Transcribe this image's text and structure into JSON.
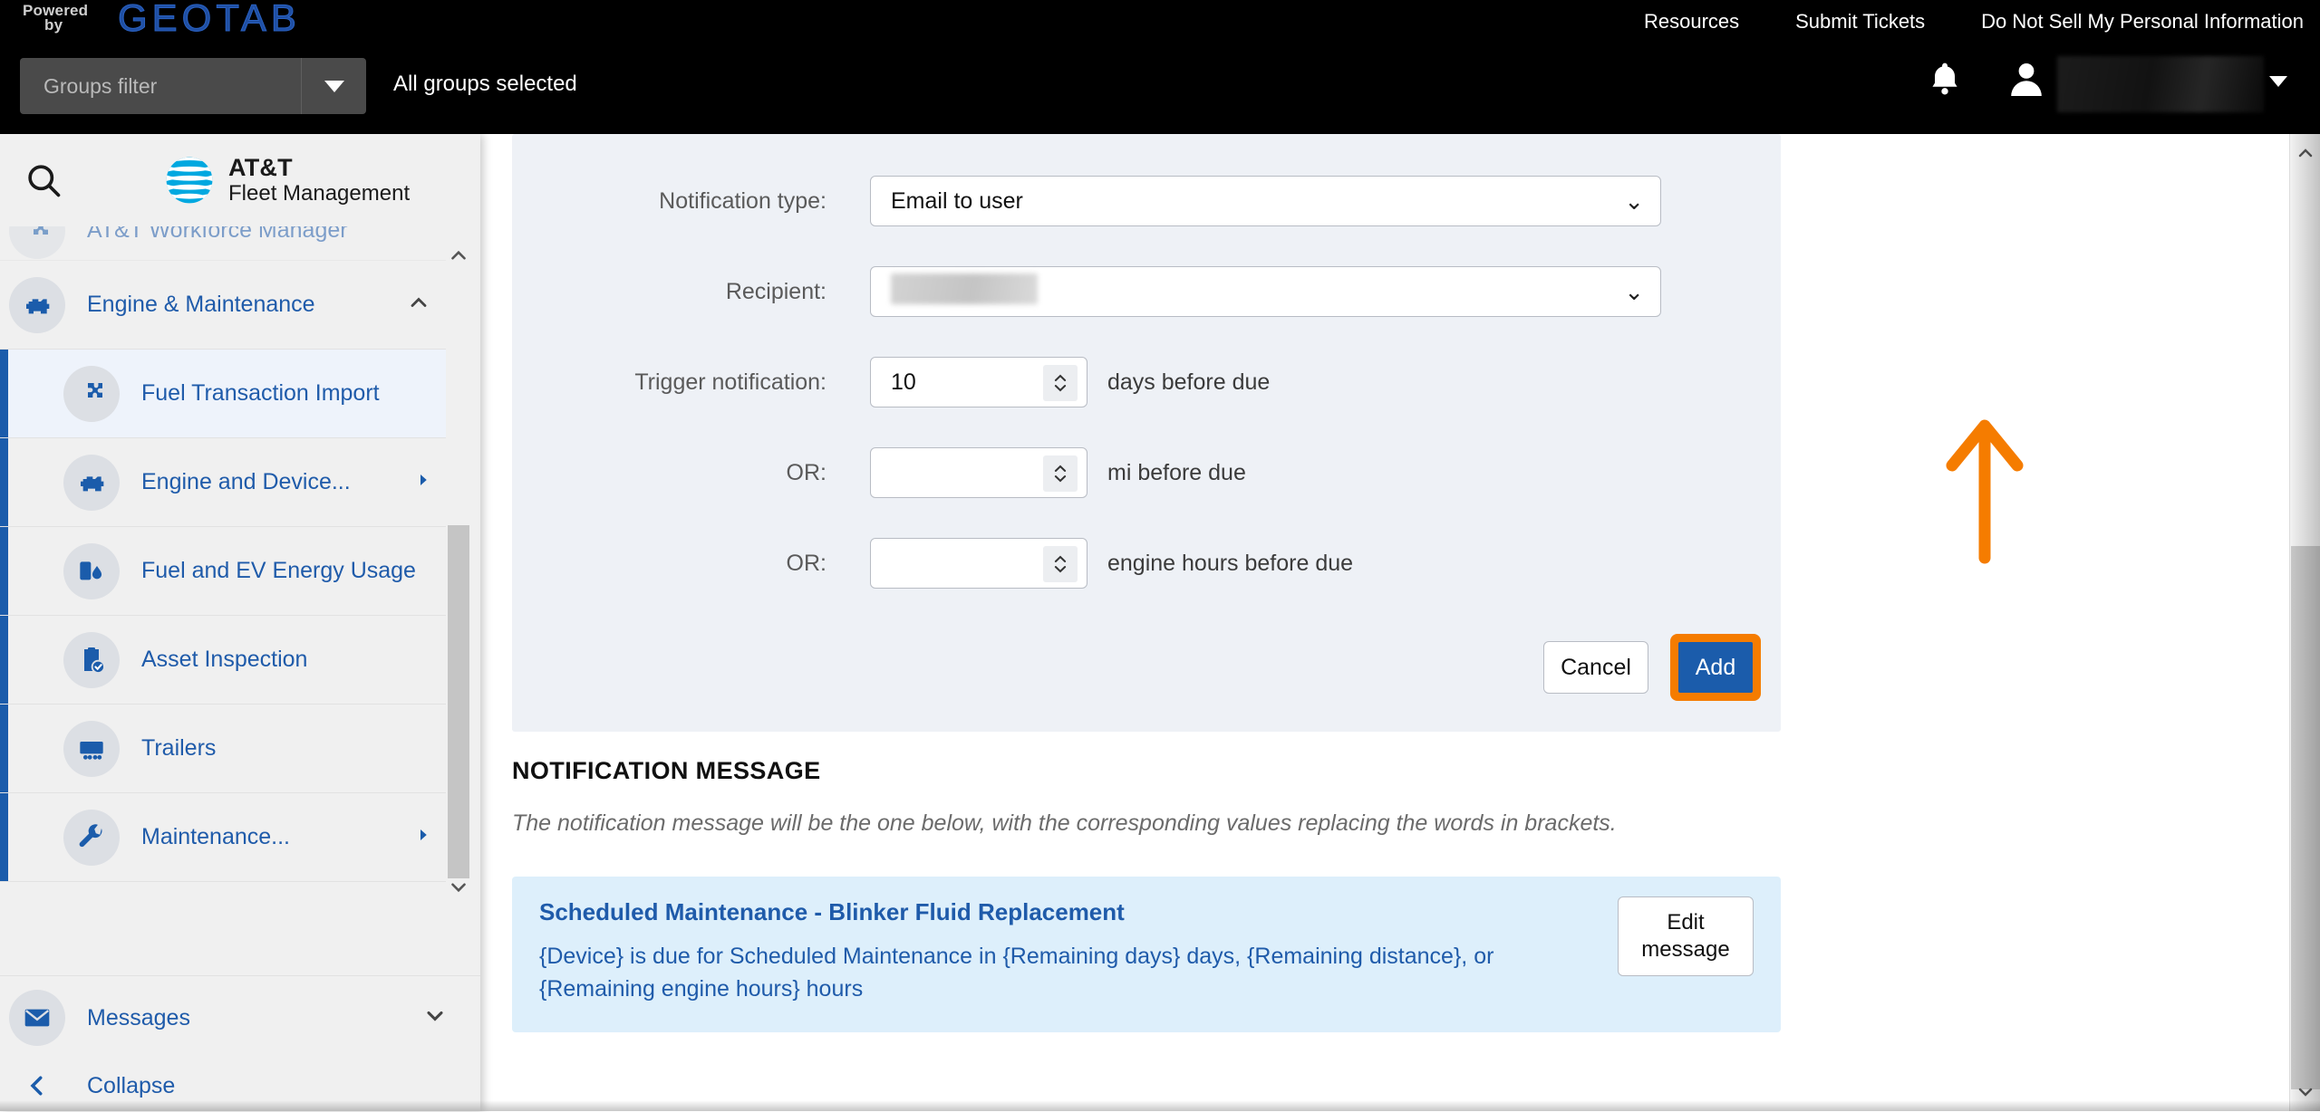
{
  "topbar": {
    "powered_line1": "Powered",
    "powered_line2": "by",
    "brand_logo": "GEOTAB",
    "nav_links": [
      {
        "label": "Resources"
      },
      {
        "label": "Submit Tickets"
      },
      {
        "label": "Do Not Sell My Personal Information"
      }
    ],
    "groups_filter_placeholder": "Groups filter",
    "groups_status": "All groups selected",
    "bell_icon": "notification-bell-icon",
    "user_icon": "user-avatar-icon",
    "user_name": "",
    "user_caret_icon": "caret-down-icon"
  },
  "sidebar": {
    "search_icon": "search-icon",
    "logo_icon": "att-globe-icon",
    "brand_line1": "AT&T",
    "brand_line2": "Fleet Management",
    "items": [
      {
        "label": "AT&T Workforce Manager",
        "icon": "puzzle-piece-icon",
        "level": "group",
        "chevron": "chevron-up-icon",
        "clipped": true
      },
      {
        "label": "Engine & Maintenance",
        "icon": "engine-icon",
        "level": "group",
        "chevron": "chevron-up-icon",
        "expanded": true
      },
      {
        "label": "Fuel Transaction Import",
        "icon": "puzzle-piece-icon",
        "level": "child",
        "active": true
      },
      {
        "label": "Engine and Device...",
        "icon": "engine-icon",
        "level": "child",
        "chevron": "chevron-right-icon"
      },
      {
        "label": "Fuel and EV Energy Usage",
        "icon": "fuel-ev-icon",
        "level": "child"
      },
      {
        "label": "Asset Inspection",
        "icon": "clipboard-check-icon",
        "level": "child"
      },
      {
        "label": "Trailers",
        "icon": "trailer-icon",
        "level": "child"
      },
      {
        "label": "Maintenance...",
        "icon": "wrench-icon",
        "level": "child",
        "chevron": "chevron-right-icon"
      }
    ],
    "bottom_items": [
      {
        "label": "Messages",
        "icon": "envelope-icon",
        "chevron": "chevron-down-icon"
      },
      {
        "label": "Collapse",
        "icon": "chevron-left-icon"
      }
    ],
    "scrollbar": {
      "up_icon": "chevron-up-icon",
      "down_icon": "chevron-down-icon"
    }
  },
  "form": {
    "rows": [
      {
        "label": "Notification type:",
        "value": "Email to user",
        "control": "select",
        "chevron": "chevron-down-icon"
      },
      {
        "label": "Recipient:",
        "value": "",
        "control": "select-redacted",
        "chevron": "chevron-down-icon"
      },
      {
        "label": "Trigger notification:",
        "value": "10",
        "control": "number",
        "unit": "days before due"
      },
      {
        "label": "OR:",
        "value": "",
        "control": "number",
        "unit": "mi before due"
      },
      {
        "label": "OR:",
        "value": "",
        "control": "number",
        "unit": "engine hours before due"
      }
    ],
    "cancel_label": "Cancel",
    "add_label": "Add"
  },
  "notification_message": {
    "section_title": "NOTIFICATION MESSAGE",
    "description": "The notification message will be the one below, with the corresponding values replacing the words in brackets.",
    "card_title": "Scheduled Maintenance - Blinker Fluid Replacement",
    "card_body": "{Device} is due for Scheduled Maintenance in {Remaining days} days, {Remaining distance}, or {Remaining engine hours} hours",
    "edit_line1": "Edit",
    "edit_line2": "message"
  },
  "annotation": {
    "arrow_icon": "orange-up-arrow-annotation",
    "arrow_color": "#f57c00",
    "highlight_color": "#f57c00"
  },
  "page_scrollbar": {
    "up_icon": "chevron-up-icon",
    "down_icon": "chevron-down-icon"
  },
  "colors": {
    "header_bg": "#000000",
    "brand_blue": "#1b5cab",
    "link_blue": "#1f5baa",
    "panel_bg": "#eef1f6",
    "message_card_bg": "#ddeffb",
    "accent_orange": "#f57c00"
  }
}
